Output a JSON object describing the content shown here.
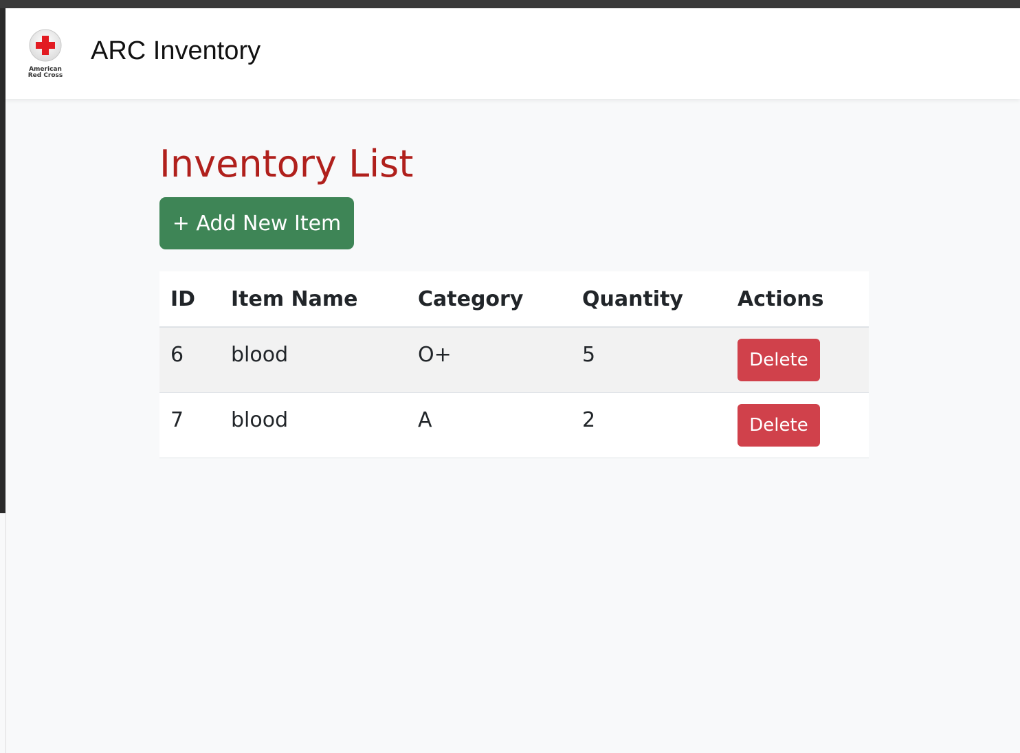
{
  "navbar": {
    "logo_text_line1": "American",
    "logo_text_line2": "Red Cross",
    "title": "ARC Inventory"
  },
  "page": {
    "title": "Inventory List",
    "add_button_label": "+ Add New Item"
  },
  "table": {
    "headers": {
      "id": "ID",
      "name": "Item Name",
      "category": "Category",
      "quantity": "Quantity",
      "actions": "Actions"
    },
    "rows": [
      {
        "id": "6",
        "name": "blood",
        "category": "O+",
        "quantity": "5",
        "action_label": "Delete"
      },
      {
        "id": "7",
        "name": "blood",
        "category": "A",
        "quantity": "2",
        "action_label": "Delete"
      }
    ]
  },
  "colors": {
    "brand_red": "#b0201c",
    "add_button": "#3e8556",
    "delete_button": "#d0414b"
  },
  "icons": {
    "logo": "red-cross-icon"
  }
}
